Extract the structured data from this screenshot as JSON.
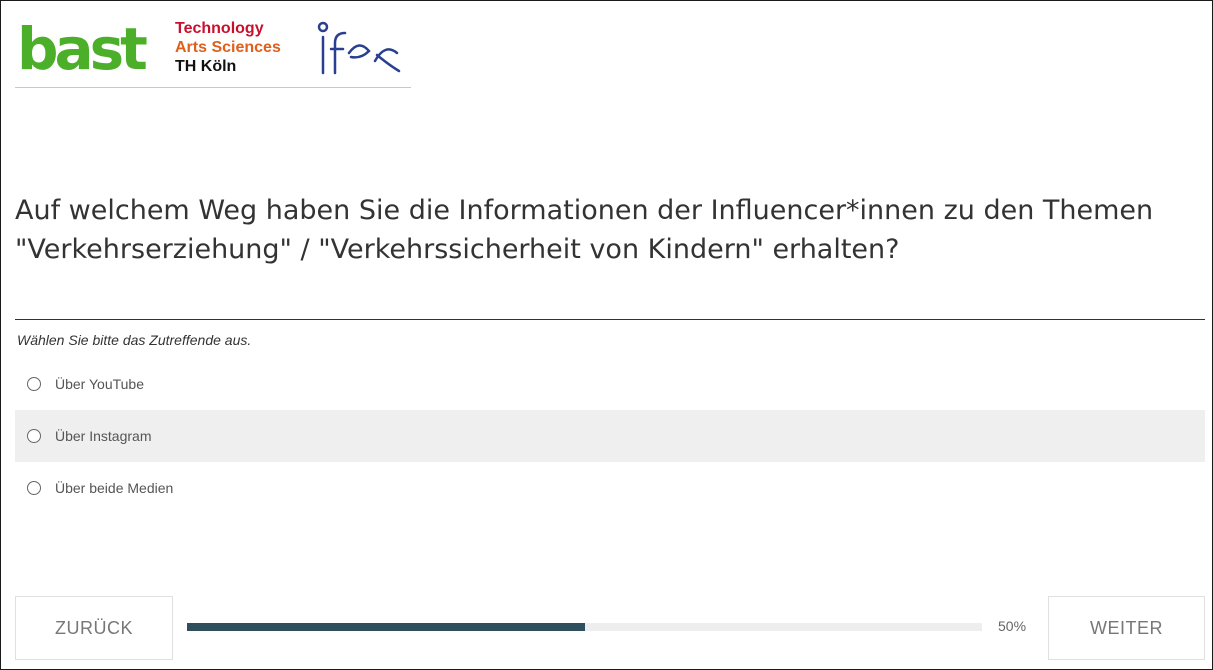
{
  "header": {
    "logo_bast": "bast",
    "logo_th_line1": "Technology",
    "logo_th_line2": "Arts Sciences",
    "logo_th_line3": "TH Köln",
    "logo_ifes": "ifes"
  },
  "question": {
    "title": "Auf welchem Weg haben Sie die Informationen der Influencer*innen zu den Themen \"Verkehrserziehung\" / \"Verkehrssicherheit von Kindern\" erhalten?",
    "help": "Wählen Sie bitte das Zutreffende aus.",
    "options": [
      {
        "label": "Über YouTube"
      },
      {
        "label": "Über Instagram"
      },
      {
        "label": "Über beide Medien"
      }
    ]
  },
  "footer": {
    "back_label": "ZURÜCK",
    "next_label": "WEITER",
    "progress_text": "50%",
    "progress_value": 0.5
  },
  "colors": {
    "bast_green": "#4caf29",
    "progress_fill": "#2f4f5f",
    "option_highlight": "#efefef"
  }
}
